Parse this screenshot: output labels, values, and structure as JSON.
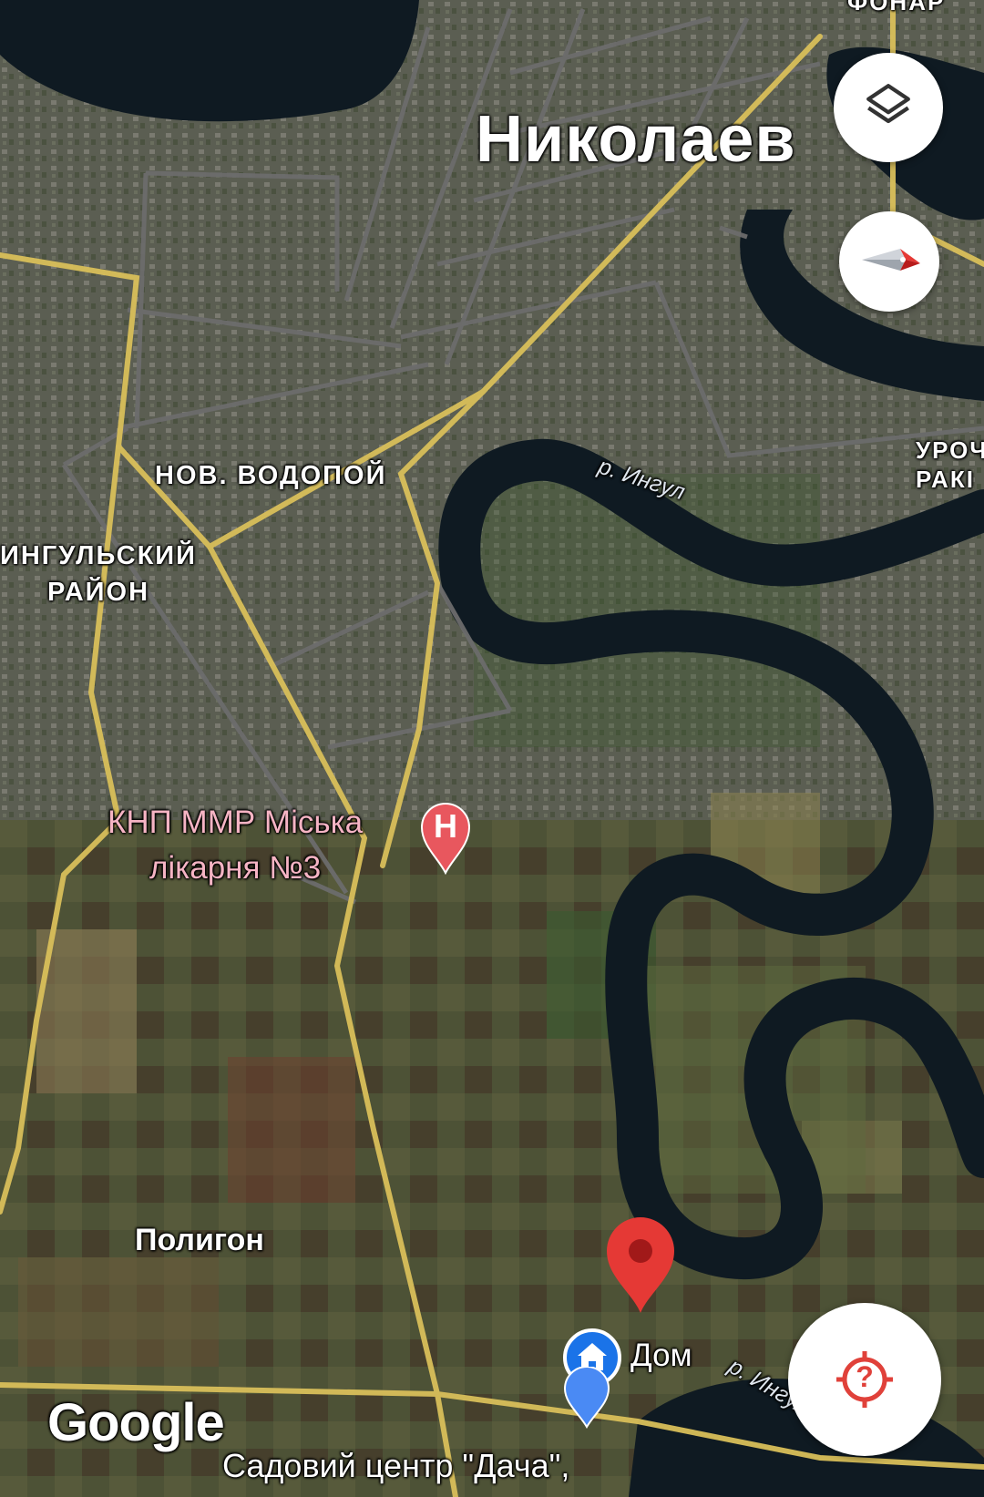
{
  "labels": {
    "city": "Николаев",
    "district_nov_vodopoy": "НОВ. ВОДОПОЙ",
    "district_ingulsky_line1": "ИНГУЛЬСКИЙ",
    "district_ingulsky_line2": "РАЙОН",
    "river_top": "р. Ингул",
    "river_bottom": "р. Ингул",
    "polygon": "Полигон",
    "uroch_line1": "УРОЧ",
    "uroch_line2": "РАКІ",
    "top_cut": "ФОНАР"
  },
  "pois": {
    "hospital_line1": "КНП ММР Міська",
    "hospital_line2": "лікарня №3",
    "hospital_icon_letter": "H",
    "home": "Дом",
    "garden_center": "Садовий центр \"Дача\","
  },
  "branding": {
    "google": "Google"
  },
  "controls": {
    "layers_icon": "layers-icon",
    "compass_icon": "compass-icon",
    "locate_icon": "location-help-icon",
    "locate_symbol": "?"
  },
  "colors": {
    "pin_red": "#e53935",
    "home_blue": "#1a73e8",
    "road_yellow": "#d9bf5a",
    "road_gray": "#6c6c6c",
    "water": "#0f1a22"
  }
}
